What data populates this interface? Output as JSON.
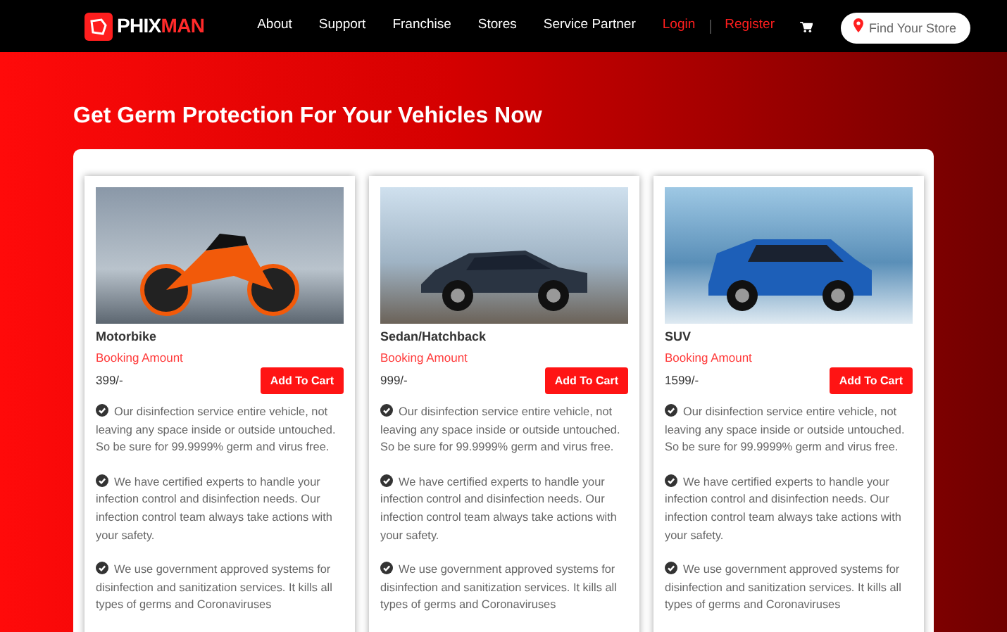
{
  "brand": {
    "first": "PHIX",
    "second": "MAN"
  },
  "nav": [
    {
      "label": "About",
      "highlighted": false
    },
    {
      "label": "Support",
      "highlighted": false
    },
    {
      "label": "Franchise",
      "highlighted": false
    },
    {
      "label": "Stores",
      "highlighted": false
    },
    {
      "label": "Service Partner",
      "highlighted": false
    },
    {
      "label": "Login",
      "highlighted": true
    },
    {
      "label": "Register",
      "highlighted": true
    }
  ],
  "store_search": {
    "placeholder": "Find Your Store"
  },
  "heading": "Get Germ Protection For Your Vehicles Now",
  "cards": [
    {
      "kind": "bike",
      "name": "Motorbike",
      "booking_label": "Booking Amount",
      "price": "399/-",
      "button": "Add To Cart",
      "features": [
        "Our disinfection service entire vehicle, not leaving any space inside or outside untouched. So be sure for 99.9999% germ and virus free.",
        "We have certified experts to handle your infection control and disinfection needs. Our infection control team always take actions with your safety.",
        "We use government approved systems for disinfection and sanitization services. It kills all types of germs and Coronaviruses"
      ]
    },
    {
      "kind": "sedan",
      "name": "Sedan/Hatchback",
      "booking_label": "Booking Amount",
      "price": "999/-",
      "button": "Add To Cart",
      "features": [
        "Our disinfection service entire vehicle, not leaving any space inside or outside untouched. So be sure for 99.9999% germ and virus free.",
        "We have certified experts to handle your infection control and disinfection needs. Our infection control team always take actions with your safety.",
        "We use government approved systems for disinfection and sanitization services. It kills all types of germs and Coronaviruses"
      ]
    },
    {
      "kind": "suv",
      "name": "SUV",
      "booking_label": "Booking Amount",
      "price": "1599/-",
      "button": "Add To Cart",
      "features": [
        "Our disinfection service entire vehicle, not leaving any space inside or outside untouched. So be sure for 99.9999% germ and virus free.",
        "We have certified experts to handle your infection control and disinfection needs. Our infection control team always take actions with your safety.",
        "We use government approved systems for disinfection and sanitization services. It kills all types of germs and Coronaviruses"
      ]
    }
  ]
}
